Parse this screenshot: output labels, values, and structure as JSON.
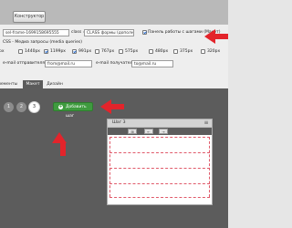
{
  "topbar": {
    "constructor_label": "Конструктор"
  },
  "settings": {
    "id_value": "sel-frame-1699158695555",
    "class_label": "class =",
    "class_value": "CLASS формы (дополнител",
    "panel_label": "Панель работы с шагами (Макет)",
    "media_title": "CSS - Медиа запросы (media queries)",
    "media_options": [
      {
        "label": "px",
        "checked": false
      },
      {
        "label": "1440px",
        "checked": false
      },
      {
        "label": "1199px",
        "checked": true
      },
      {
        "label": "991px",
        "checked": true
      },
      {
        "label": "767px",
        "checked": false
      },
      {
        "label": "575px",
        "checked": false
      },
      {
        "label": "480px",
        "checked": false
      },
      {
        "label": "375px",
        "checked": false
      },
      {
        "label": "320px",
        "checked": false
      }
    ],
    "sender_label": "e-mail отправителя",
    "sender_value": "from@mail.ru",
    "recipient_label": "e-mail получателя",
    "recipient_value": "to@mail.ru"
  },
  "tabs": [
    "Элементы",
    "Макет",
    "Дизайн"
  ],
  "steps": {
    "numbers": [
      "1",
      "2",
      "3"
    ],
    "add_label": "Добавить шаг"
  },
  "step_panel": {
    "title": "Шаг 3",
    "tools": [
      "⊞",
      "←",
      "→"
    ]
  },
  "colors": {
    "accent_green": "#3f9b3f",
    "arrow_red": "#e3242b",
    "dashed_guides": "#e05a6a",
    "dark_bg": "#5c5c5c"
  }
}
